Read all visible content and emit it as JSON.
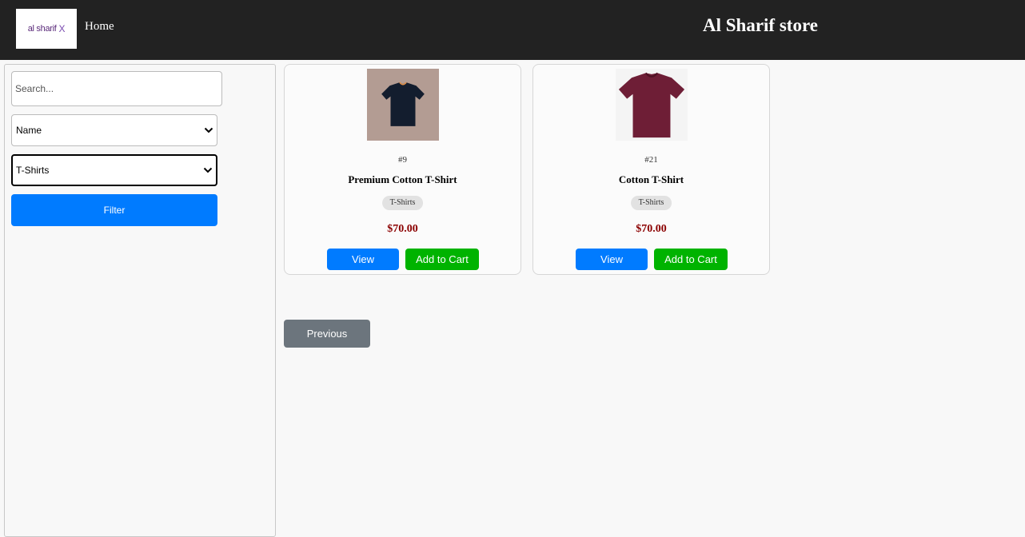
{
  "header": {
    "logo_text": "al sharif",
    "logo_mark": "X",
    "home_label": "Home",
    "store_title": "Al Sharif store"
  },
  "sidebar": {
    "search_placeholder": "Search...",
    "sort_selected": "Name",
    "category_selected": "T-Shirts",
    "filter_label": "Filter"
  },
  "products": [
    {
      "id_label": "#9",
      "name": "Premium Cotton T-Shirt",
      "category": "T-Shirts",
      "price": "$70.00",
      "image_icon": "navy-tshirt-icon",
      "color": "#131d2e",
      "view_label": "View",
      "cart_label": "Add to Cart"
    },
    {
      "id_label": "#21",
      "name": "Cotton T-Shirt",
      "category": "T-Shirts",
      "price": "$70.00",
      "image_icon": "maroon-tshirt-icon",
      "color": "#6e1e36",
      "view_label": "View",
      "cart_label": "Add to Cart"
    }
  ],
  "pagination": {
    "previous_label": "Previous"
  },
  "colors": {
    "header_bg": "#222222",
    "primary": "#007bff",
    "success": "#00b300",
    "secondary": "#6c757d",
    "price": "#8b0000"
  }
}
